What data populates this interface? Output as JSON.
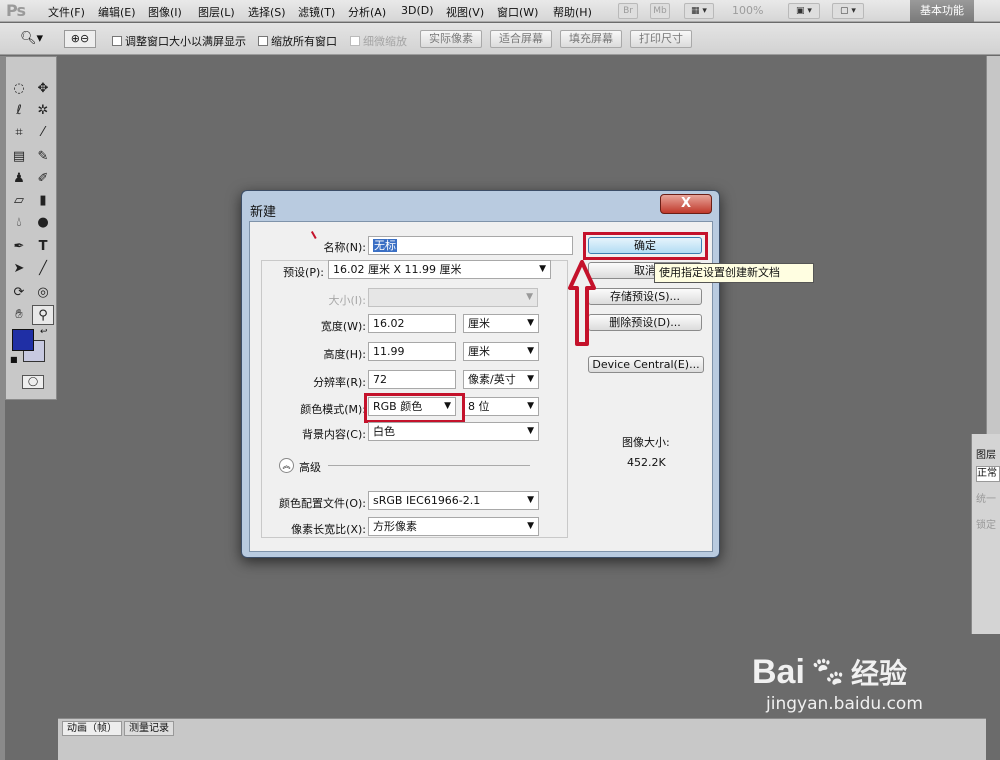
{
  "app": {
    "logo": "Ps",
    "workspace": "基本功能"
  },
  "menu": [
    "文件(F)",
    "编辑(E)",
    "图像(I)",
    "图层(L)",
    "选择(S)",
    "滤镜(T)",
    "分析(A)",
    "3D(D)",
    "视图(V)",
    "窗口(W)",
    "帮助(H)"
  ],
  "menubar_extras": {
    "br": "Br",
    "mb": "Mb",
    "zoom": "100%"
  },
  "options": {
    "resize_windows": "调整窗口大小以满屏显示",
    "zoom_all": "缩放所有窗口",
    "scrubby": "细微缩放",
    "actual_pixels": "实际像素",
    "fit_screen": "适合屏幕",
    "fill_screen": "填充屏幕",
    "print_size": "打印尺寸"
  },
  "colors": {
    "foreground": "#1f2fa5",
    "background": "#c7c9e0",
    "highlight": "#c4122b"
  },
  "dialog": {
    "title": "新建",
    "close": "X",
    "name_label": "名称(N):",
    "name_value": "无标",
    "preset_label": "预设(P):",
    "preset_value": "16.02 厘米 X 11.99 厘米",
    "size_label": "大小(I):",
    "width_label": "宽度(W):",
    "width_value": "16.02",
    "width_unit": "厘米",
    "height_label": "高度(H):",
    "height_value": "11.99",
    "height_unit": "厘米",
    "resolution_label": "分辨率(R):",
    "resolution_value": "72",
    "resolution_unit": "像素/英寸",
    "color_mode_label": "颜色模式(M):",
    "color_mode_value": "RGB 颜色",
    "bit_depth": "8 位",
    "background_label": "背景内容(C):",
    "background_value": "白色",
    "advanced_label": "高级",
    "color_profile_label": "颜色配置文件(O):",
    "color_profile_value": "sRGB IEC61966-2.1",
    "pixel_aspect_label": "像素长宽比(X):",
    "pixel_aspect_value": "方形像素",
    "ok": "确定",
    "cancel": "取消",
    "save_preset": "存储预设(S)...",
    "delete_preset": "删除预设(D)...",
    "device_central": "Device Central(E)...",
    "image_size_label": "图像大小:",
    "image_size_value": "452.2K"
  },
  "tooltip": "使用指定设置创建新文档",
  "bottom_tabs": [
    "动画（帧）",
    "测量记录"
  ],
  "layers_panel": {
    "tab": "图层",
    "mode": "正常",
    "unify": "统一",
    "lock": "锁定"
  },
  "watermark": {
    "brand": "Bai",
    "brand_tail": "经验",
    "url": "jingyan.baidu.com"
  }
}
